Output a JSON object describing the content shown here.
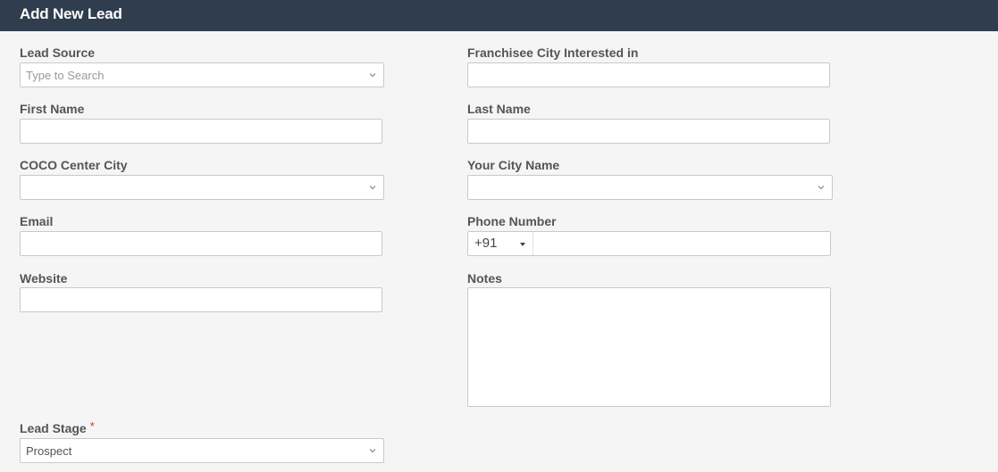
{
  "header": {
    "title": "Add New Lead"
  },
  "form": {
    "lead_source": {
      "label": "Lead Source",
      "placeholder": "Type to Search",
      "value": ""
    },
    "franchisee_city": {
      "label": "Franchisee City Interested in",
      "value": ""
    },
    "first_name": {
      "label": "First Name",
      "value": ""
    },
    "last_name": {
      "label": "Last Name",
      "value": ""
    },
    "coco_center_city": {
      "label": "COCO Center City",
      "value": ""
    },
    "your_city_name": {
      "label": "Your City Name",
      "value": ""
    },
    "email": {
      "label": "Email",
      "value": ""
    },
    "phone_number": {
      "label": "Phone Number",
      "country_code": "+91",
      "value": ""
    },
    "website": {
      "label": "Website",
      "value": ""
    },
    "notes": {
      "label": "Notes",
      "value": ""
    },
    "lead_stage": {
      "label": "Lead Stage",
      "required_marker": "*",
      "value": "Prospect"
    }
  },
  "colors": {
    "header_bg": "#2f3d4e",
    "required": "#d9302c",
    "page_bg": "#f5f5f5"
  },
  "icons": {
    "dropdown": "chevron-down-icon",
    "phone_caret": "caret-down-icon"
  }
}
